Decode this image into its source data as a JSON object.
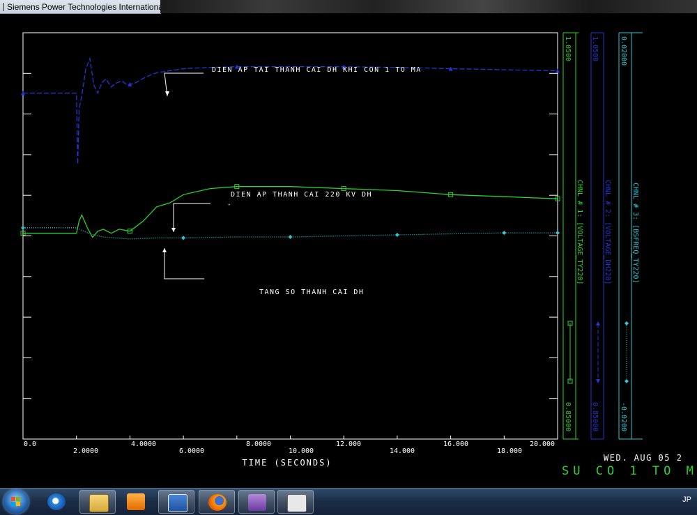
{
  "window": {
    "title": "Siemens Power Technologies Internationa"
  },
  "plot": {
    "xaxis_label": "TIME (SECONDS)",
    "x_ticks_top": [
      "0.0",
      "4.0000",
      "8.0000",
      "12.000",
      "16.000",
      "20.000"
    ],
    "x_ticks_bottom": [
      "2.0000",
      "6.0000",
      "10.000",
      "14.000",
      "18.000"
    ],
    "annotations": {
      "blue": "DIEN AP TAI THANH CAI DH KHI CON 1 TO MA",
      "green": "DIEN AP THANH CAI 220 KV DH",
      "cyan": "TANG SO THANH CAI DH"
    },
    "channels": [
      {
        "label": "CHNL # 1: [VOLTAGE_TY220]",
        "max": "1.0500",
        "min": "0.85000",
        "color": "#2fd22f"
      },
      {
        "label": "CHNL # 2: [VOLTAGE_DH220]",
        "max": "1.0500",
        "min": "0.85000",
        "color": "#2436d6"
      },
      {
        "label": "CHNL # 3: [BSFREQ_TY220]",
        "max": "0.02000",
        "min": "-0.0200",
        "color": "#2fc8d6"
      }
    ],
    "footer": {
      "date": "WED. AUG 05 2",
      "case_title": "SU CO 1 TO M"
    }
  },
  "chart_data": {
    "type": "line",
    "xlabel": "TIME (SECONDS)",
    "xlim": [
      0,
      20
    ],
    "series": [
      {
        "name": "CHNL # 1: [VOLTAGE_TY220]",
        "ylim": [
          0.85,
          1.05
        ],
        "x": [
          0,
          1.0,
          2.0,
          2.1,
          2.2,
          2.4,
          2.6,
          2.8,
          3.0,
          3.3,
          3.6,
          4.0,
          4.5,
          5.0,
          5.5,
          6.0,
          7.0,
          8.0,
          10.0,
          12.0,
          14.0,
          16.0,
          18.0,
          20.0
        ],
        "values": [
          0.9513,
          0.9513,
          0.9513,
          0.9573,
          0.9603,
          0.9543,
          0.9493,
          0.9523,
          0.9533,
          0.9513,
          0.9533,
          0.9523,
          0.9573,
          0.9643,
          0.9663,
          0.9703,
          0.9733,
          0.9743,
          0.9743,
          0.9733,
          0.9723,
          0.9703,
          0.9693,
          0.9683
        ]
      },
      {
        "name": "CHNL # 2: [VOLTAGE_DH220]",
        "ylim": [
          0.85,
          1.05
        ],
        "x": [
          0,
          1.0,
          2.0,
          2.05,
          2.1,
          2.2,
          2.35,
          2.5,
          2.65,
          2.8,
          2.95,
          3.1,
          3.3,
          3.5,
          3.7,
          3.9,
          4.2,
          4.6,
          5.0,
          5.5,
          6.0,
          7.0,
          8.0,
          10.0,
          12.0,
          14.0,
          16.0,
          18.0,
          20.0
        ],
        "values": [
          1.0203,
          1.0203,
          1.0203,
          0.9853,
          1.0123,
          1.0193,
          1.0323,
          1.0373,
          1.0243,
          1.0203,
          1.0253,
          1.0273,
          1.0233,
          1.0253,
          1.0263,
          1.0243,
          1.0253,
          1.0283,
          1.0303,
          1.0313,
          1.0323,
          1.033,
          1.0333,
          1.0333,
          1.0333,
          1.033,
          1.0323,
          1.0318,
          1.0313
        ]
      },
      {
        "name": "CHNL # 3: [BSFREQ_TY220]",
        "ylim": [
          -0.02,
          0.02
        ],
        "x": [
          0,
          1.0,
          2.0,
          2.5,
          3.0,
          4.0,
          5.0,
          6.0,
          8.0,
          10.0,
          12.0,
          14.0,
          16.0,
          18.0,
          20.0
        ],
        "values": [
          0.0008,
          0.0008,
          0.0008,
          0.0002,
          -0.0001,
          -0.0003,
          -0.0002,
          -0.0002,
          -0.0001,
          -0.0001,
          0.0,
          0.0001,
          0.0002,
          0.0003,
          0.0003
        ]
      }
    ]
  },
  "taskbar": {
    "apps": [
      "start-orb",
      "internet-explorer-icon",
      "file-explorer-icon",
      "media-player-icon",
      "word-icon",
      "firefox-icon",
      "onenote-icon",
      "pss-plot-icon"
    ],
    "tray_text": "JP"
  }
}
